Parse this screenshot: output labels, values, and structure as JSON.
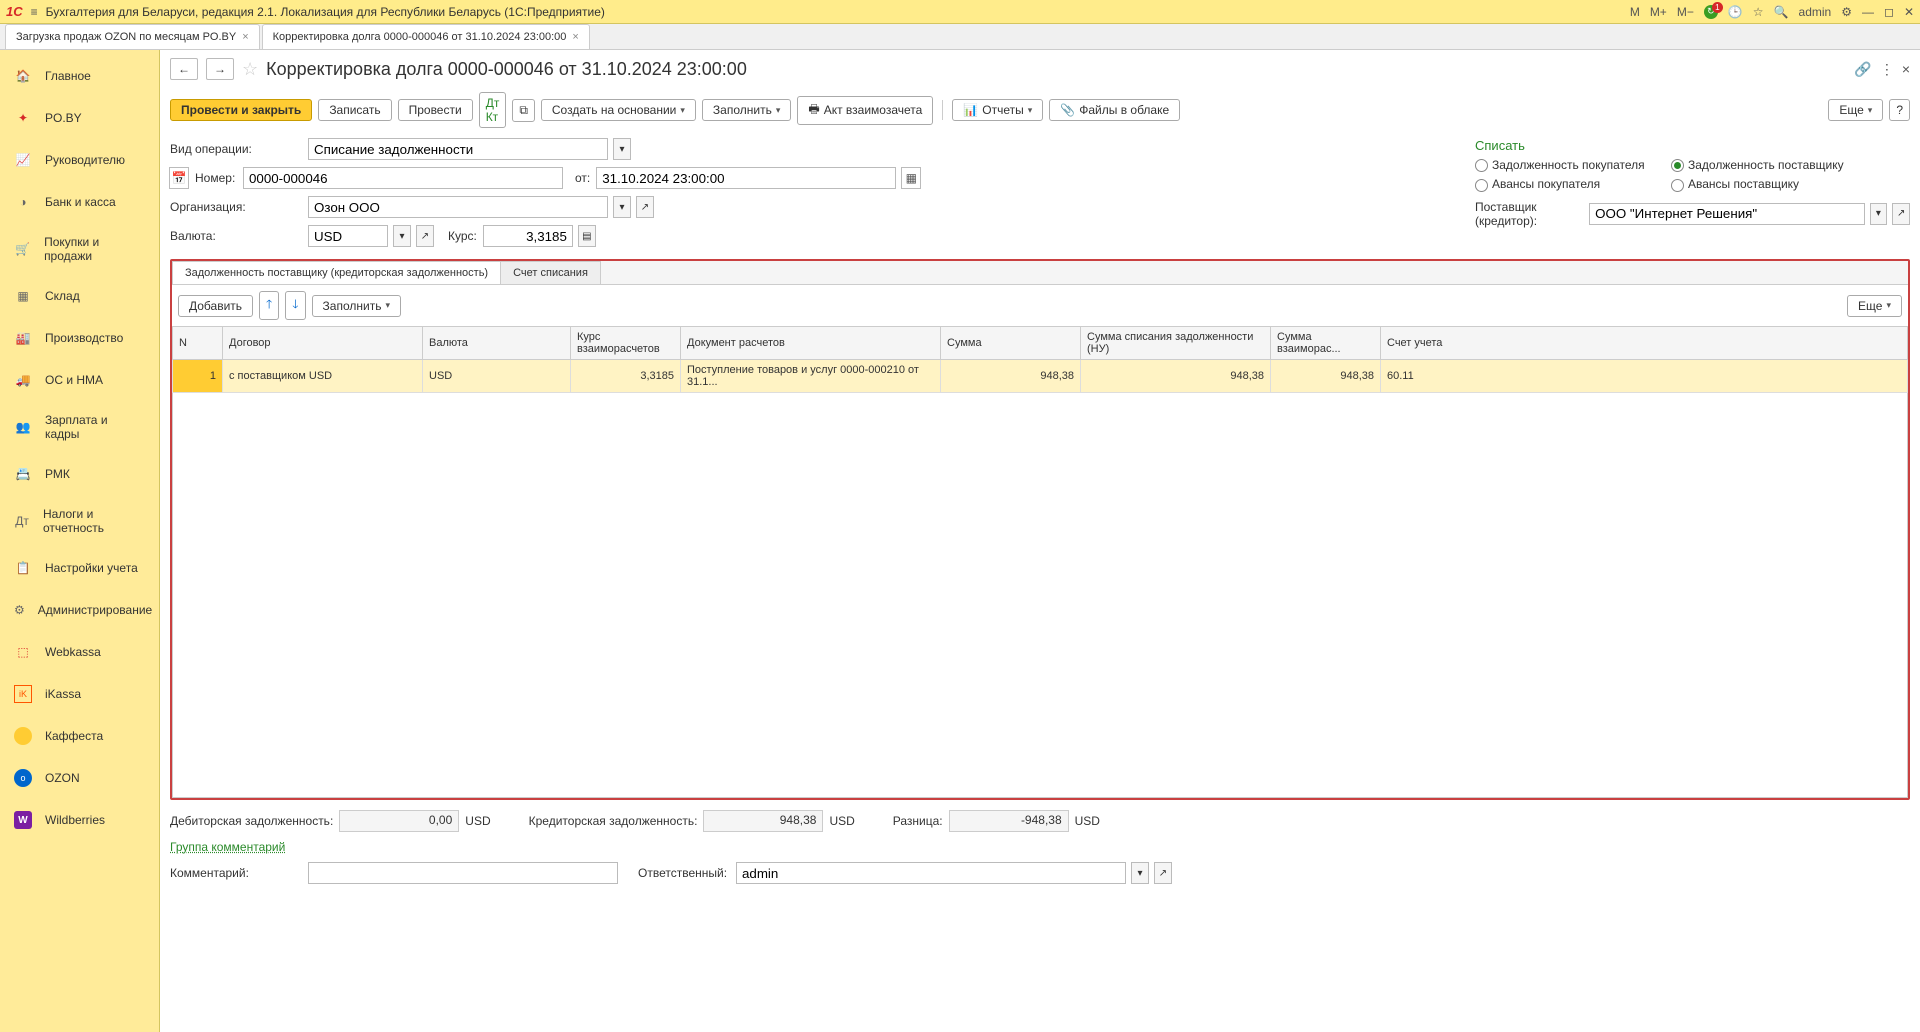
{
  "topbar": {
    "title": "Бухгалтерия для Беларуси, редакция 2.1. Локализация для Республики Беларусь   (1С:Предприятие)",
    "m": "M",
    "mplus": "M+",
    "mminus": "M−",
    "user": "admin"
  },
  "tabs": [
    {
      "label": "Загрузка продаж OZON по месяцам PO.BY"
    },
    {
      "label": "Корректировка долга 0000-000046 от 31.10.2024 23:00:00"
    }
  ],
  "sidebar": [
    {
      "label": "Главное",
      "icon": "home"
    },
    {
      "label": "PO.BY",
      "icon": "star-red"
    },
    {
      "label": "Руководителю",
      "icon": "chart"
    },
    {
      "label": "Банк и касса",
      "icon": "wallet"
    },
    {
      "label": "Покупки и продажи",
      "icon": "cart"
    },
    {
      "label": "Склад",
      "icon": "boxes"
    },
    {
      "label": "Производство",
      "icon": "factory"
    },
    {
      "label": "ОС и НМА",
      "icon": "truck"
    },
    {
      "label": "Зарплата и кадры",
      "icon": "people"
    },
    {
      "label": "РМК",
      "icon": "register"
    },
    {
      "label": "Налоги и отчетность",
      "icon": "tax"
    },
    {
      "label": "Настройки учета",
      "icon": "clipboard"
    },
    {
      "label": "Администрирование",
      "icon": "gear"
    },
    {
      "label": "Webkassa",
      "icon": "wk"
    },
    {
      "label": "iKassa",
      "icon": "ik"
    },
    {
      "label": "Каффеста",
      "icon": "kf"
    },
    {
      "label": "OZON",
      "icon": "ozon"
    },
    {
      "label": "Wildberries",
      "icon": "wb"
    }
  ],
  "doc": {
    "title": "Корректировка долга 0000-000046 от 31.10.2024 23:00:00",
    "toolbar": {
      "post_close": "Провести и закрыть",
      "write": "Записать",
      "post": "Провести",
      "create_based": "Создать на основании",
      "fill": "Заполнить",
      "act": "Акт взаимозачета",
      "reports": "Отчеты",
      "files": "Файлы в облаке",
      "more": "Еще"
    },
    "labels": {
      "operation": "Вид операции:",
      "number": "Номер:",
      "from": "от:",
      "org": "Организация:",
      "currency": "Валюта:",
      "rate": "Курс:",
      "writeoff": "Списать",
      "r1": "Задолженность покупателя",
      "r2": "Задолженность поставщику",
      "r3": "Авансы покупателя",
      "r4": "Авансы поставщику",
      "supplier": "Поставщик (кредитор):"
    },
    "fields": {
      "operation": "Списание задолженности",
      "number": "0000-000046",
      "date": "31.10.2024 23:00:00",
      "org": "Озон ООО",
      "currency": "USD",
      "rate": "3,3185",
      "supplier": "ООО \"Интернет Решения\""
    },
    "panel": {
      "tab1": "Задолженность поставщику (кредиторская задолженность)",
      "tab2": "Счет списания",
      "add": "Добавить",
      "fill": "Заполнить",
      "more": "Еще",
      "headers": {
        "n": "N",
        "contract": "Договор",
        "curr": "Валюта",
        "rate": "Курс взаиморасчетов",
        "doc": "Документ расчетов",
        "sum": "Сумма",
        "sum_nu": "Сумма списания задолженности (НУ)",
        "sum_vz": "Сумма взаиморас...",
        "account": "Счет учета"
      },
      "row": {
        "n": "1",
        "contract": "с поставщиком USD",
        "curr": "USD",
        "rate": "3,3185",
        "doc": "Поступление товаров и услуг 0000-000210 от 31.1...",
        "sum": "948,38",
        "sum_nu": "948,38",
        "sum_vz": "948,38",
        "account": "60.11"
      }
    },
    "footer": {
      "deb_label": "Дебиторская задолженность:",
      "deb": "0,00",
      "deb_cur": "USD",
      "cred_label": "Кредиторская задолженность:",
      "cred": "948,38",
      "cred_cur": "USD",
      "diff_label": "Разница:",
      "diff": "-948,38",
      "diff_cur": "USD",
      "group_comments": "Группа комментарий",
      "comment_label": "Комментарий:",
      "resp_label": "Ответственный:",
      "resp": "admin"
    }
  }
}
